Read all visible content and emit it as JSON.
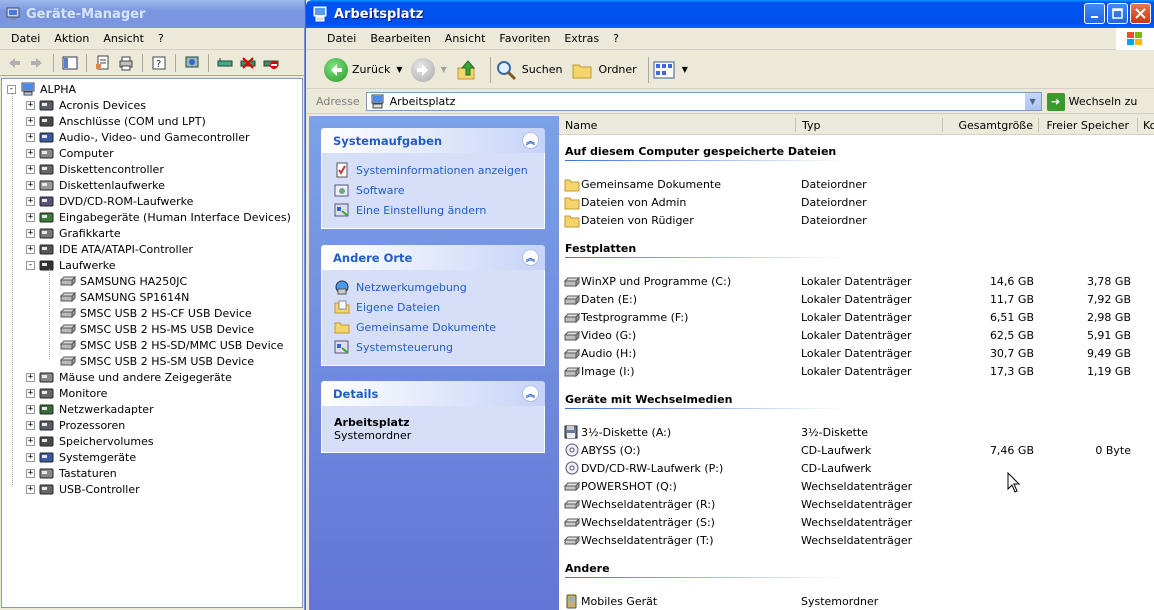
{
  "device_manager": {
    "title": "Geräte-Manager",
    "menu": [
      "Datei",
      "Aktion",
      "Ansicht",
      "?"
    ],
    "tree": [
      {
        "label": "ALPHA",
        "level": 0,
        "expander": "-"
      },
      {
        "label": "Acronis Devices",
        "level": 1,
        "expander": "+"
      },
      {
        "label": "Anschlüsse (COM und LPT)",
        "level": 1,
        "expander": "+"
      },
      {
        "label": "Audio-, Video- und Gamecontroller",
        "level": 1,
        "expander": "+"
      },
      {
        "label": "Computer",
        "level": 1,
        "expander": "+"
      },
      {
        "label": "Diskettencontroller",
        "level": 1,
        "expander": "+"
      },
      {
        "label": "Diskettenlaufwerke",
        "level": 1,
        "expander": "+"
      },
      {
        "label": "DVD/CD-ROM-Laufwerke",
        "level": 1,
        "expander": "+"
      },
      {
        "label": "Eingabegeräte (Human Interface Devices)",
        "level": 1,
        "expander": "+"
      },
      {
        "label": "Grafikkarte",
        "level": 1,
        "expander": "+"
      },
      {
        "label": "IDE ATA/ATAPI-Controller",
        "level": 1,
        "expander": "+"
      },
      {
        "label": "Laufwerke",
        "level": 1,
        "expander": "-"
      },
      {
        "label": "SAMSUNG HA250JC",
        "level": 2,
        "expander": ""
      },
      {
        "label": "SAMSUNG SP1614N",
        "level": 2,
        "expander": ""
      },
      {
        "label": "SMSC USB 2 HS-CF USB Device",
        "level": 2,
        "expander": ""
      },
      {
        "label": "SMSC USB 2 HS-MS USB Device",
        "level": 2,
        "expander": ""
      },
      {
        "label": "SMSC USB 2 HS-SD/MMC USB Device",
        "level": 2,
        "expander": ""
      },
      {
        "label": "SMSC USB 2 HS-SM USB Device",
        "level": 2,
        "expander": ""
      },
      {
        "label": "Mäuse und andere Zeigegeräte",
        "level": 1,
        "expander": "+"
      },
      {
        "label": "Monitore",
        "level": 1,
        "expander": "+"
      },
      {
        "label": "Netzwerkadapter",
        "level": 1,
        "expander": "+"
      },
      {
        "label": "Prozessoren",
        "level": 1,
        "expander": "+"
      },
      {
        "label": "Speichervolumes",
        "level": 1,
        "expander": "+"
      },
      {
        "label": "Systemgeräte",
        "level": 1,
        "expander": "+"
      },
      {
        "label": "Tastaturen",
        "level": 1,
        "expander": "+"
      },
      {
        "label": "USB-Controller",
        "level": 1,
        "expander": "+"
      }
    ]
  },
  "explorer": {
    "title": "Arbeitsplatz",
    "menu": [
      "Datei",
      "Bearbeiten",
      "Ansicht",
      "Favoriten",
      "Extras",
      "?"
    ],
    "toolbar": {
      "back": "Zurück",
      "search": "Suchen",
      "folders": "Ordner"
    },
    "address": {
      "label": "Adresse",
      "value": "Arbeitsplatz",
      "go": "Wechseln zu"
    },
    "panels": {
      "system_tasks": {
        "title": "Systemaufgaben",
        "items": [
          "Systeminformationen anzeigen",
          "Software",
          "Eine Einstellung ändern"
        ]
      },
      "other_places": {
        "title": "Andere Orte",
        "items": [
          "Netzwerkumgebung",
          "Eigene Dateien",
          "Gemeinsame Dokumente",
          "Systemsteuerung"
        ]
      },
      "details": {
        "title": "Details",
        "name": "Arbeitsplatz",
        "type": "Systemordner"
      }
    },
    "columns": [
      "Name",
      "Typ",
      "Gesamtgröße",
      "Freier Speicher",
      "Ko"
    ],
    "groups": [
      {
        "title": "Auf diesem Computer gespeicherte Dateien",
        "items": [
          {
            "name": "Gemeinsame Dokumente",
            "type": "Dateiordner",
            "total": "",
            "free": "",
            "icon": "folder"
          },
          {
            "name": "Dateien von Admin",
            "type": "Dateiordner",
            "total": "",
            "free": "",
            "icon": "folder"
          },
          {
            "name": "Dateien von Rüdiger",
            "type": "Dateiordner",
            "total": "",
            "free": "",
            "icon": "folder"
          }
        ]
      },
      {
        "title": "Festplatten",
        "items": [
          {
            "name": "WinXP und Programme (C:)",
            "type": "Lokaler Datenträger",
            "total": "14,6 GB",
            "free": "3,78 GB",
            "icon": "drive"
          },
          {
            "name": "Daten (E:)",
            "type": "Lokaler Datenträger",
            "total": "11,7 GB",
            "free": "7,92 GB",
            "icon": "drive"
          },
          {
            "name": "Testprogramme (F:)",
            "type": "Lokaler Datenträger",
            "total": "6,51 GB",
            "free": "2,98 GB",
            "icon": "drive"
          },
          {
            "name": "Video (G:)",
            "type": "Lokaler Datenträger",
            "total": "62,5 GB",
            "free": "5,91 GB",
            "icon": "drive"
          },
          {
            "name": "Audio (H:)",
            "type": "Lokaler Datenträger",
            "total": "30,7 GB",
            "free": "9,49 GB",
            "icon": "drive"
          },
          {
            "name": "Image (I:)",
            "type": "Lokaler Datenträger",
            "total": "17,3 GB",
            "free": "1,19 GB",
            "icon": "drive"
          }
        ]
      },
      {
        "title": "Geräte mit Wechselmedien",
        "items": [
          {
            "name": "3½-Diskette (A:)",
            "type": "3½-Diskette",
            "total": "",
            "free": "",
            "icon": "floppy"
          },
          {
            "name": "ABYSS (O:)",
            "type": "CD-Laufwerk",
            "total": "7,46 GB",
            "free": "0 Byte",
            "icon": "cd"
          },
          {
            "name": "DVD/CD-RW-Laufwerk (P:)",
            "type": "CD-Laufwerk",
            "total": "",
            "free": "",
            "icon": "cd"
          },
          {
            "name": "POWERSHOT (Q:)",
            "type": "Wechseldatenträger",
            "total": "",
            "free": "",
            "icon": "removable"
          },
          {
            "name": "Wechseldatenträger (R:)",
            "type": "Wechseldatenträger",
            "total": "",
            "free": "",
            "icon": "removable"
          },
          {
            "name": "Wechseldatenträger (S:)",
            "type": "Wechseldatenträger",
            "total": "",
            "free": "",
            "icon": "removable"
          },
          {
            "name": "Wechseldatenträger (T:)",
            "type": "Wechseldatenträger",
            "total": "",
            "free": "",
            "icon": "removable"
          }
        ]
      },
      {
        "title": "Andere",
        "items": [
          {
            "name": "Mobiles Gerät",
            "type": "Systemordner",
            "total": "",
            "free": "",
            "icon": "mobile"
          }
        ]
      }
    ]
  },
  "colors": {
    "xp_blue": "#0053ee",
    "task_link": "#215dc6",
    "desktop": "#3a6ea5"
  }
}
